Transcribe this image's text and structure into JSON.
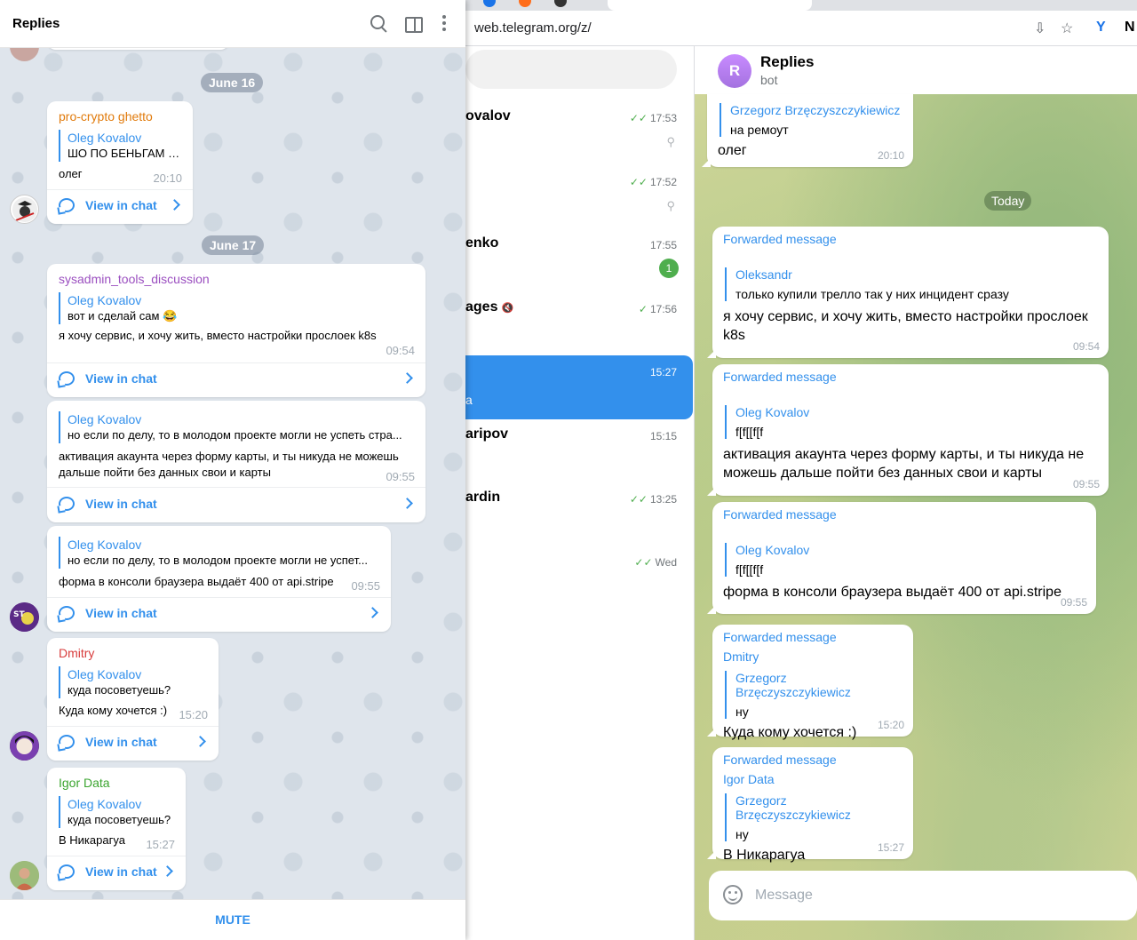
{
  "browser": {
    "url": "web.telegram.org/z/",
    "chats": [
      {
        "name": "ovalov",
        "time": "17:53",
        "check": "✓✓",
        "pinned": true
      },
      {
        "name": "",
        "time": "17:52",
        "check": "✓✓",
        "pinned": true
      },
      {
        "name": "enko",
        "time": "17:55",
        "badge": "1"
      },
      {
        "name": "ages",
        "time": "17:56",
        "check": "✓",
        "muted": true
      },
      {
        "name": "",
        "sub": "a",
        "time": "15:27",
        "active": true
      },
      {
        "name": "aripov",
        "time": "15:15"
      },
      {
        "name": "ardin",
        "time": "13:25",
        "check": "✓✓"
      },
      {
        "name": "",
        "time": "Wed",
        "check": "✓✓"
      }
    ]
  },
  "conversation": {
    "avatar_letter": "R",
    "title": "Replies",
    "subtitle": "bot",
    "today_label": "Today",
    "composer_placeholder": "Message",
    "bubbles": [
      {
        "quote_name": "Grzegorz Brzęczyszczykiewicz",
        "quote_text": "на ремоут",
        "text": "олег",
        "time": "20:10"
      },
      {
        "forwarded": "Forwarded message",
        "quote_name": "Oleksandr",
        "quote_text": "только купили трелло так у них инцидент сразу",
        "text": "я хочу сервис, и хочу жить, вместо настройки прослоек k8s",
        "time": "09:54"
      },
      {
        "forwarded": "Forwarded message",
        "quote_name": "Oleg Kovalov",
        "quote_text": "f[f[[f[f",
        "text": "активация акаунта через форму карты, и ты никуда не можешь дальше пойти без данных свои и карты",
        "time": "09:55"
      },
      {
        "forwarded": "Forwarded message",
        "quote_name": "Oleg Kovalov",
        "quote_text": "f[f[[f[f",
        "text": "форма в консоли браузера выдаёт 400 от api.stripe",
        "time": "09:55"
      },
      {
        "forwarded": "Forwarded message",
        "via": "Dmitry",
        "quote_name": "Grzegorz Brzęczyszczykiewicz",
        "quote_text": "ну",
        "text": "Куда кому хочется :)",
        "time": "15:20"
      },
      {
        "forwarded": "Forwarded message",
        "via": "Igor Data",
        "quote_name": "Grzegorz Brzęczyszczykiewicz",
        "quote_text": "ну",
        "text": "В Никарагуа",
        "time": "15:27"
      }
    ]
  },
  "replies_panel": {
    "title": "Replies",
    "dates": [
      "June 16",
      "June 17"
    ],
    "view_in_chat": "View in chat",
    "mute_label": "MUTE",
    "messages": [
      {
        "sender": "pro-crypto ghetto",
        "sender_color": "#e17b0c",
        "quote_name": "Oleg Kovalov",
        "quote_text": "ШО ПО БЕНЬГАМ ???",
        "text": "олег",
        "time": "20:10"
      },
      {
        "sender": "sysadmin_tools_discussion",
        "sender_color": "#9b4fc0",
        "quote_name": "Oleg Kovalov",
        "quote_text": "вот и сделай сам 😂",
        "text": "я хочу сервис, и хочу жить, вместо настройки прослоек k8s",
        "time": "09:54"
      },
      {
        "sender": "",
        "quote_name": "Oleg Kovalov",
        "quote_text": "но если по делу, то в молодом проекте могли не успеть стра...",
        "text": "активация акаунта через форму карты, и ты никуда не можешь дальше пойти без данных свои и карты",
        "time": "09:55"
      },
      {
        "sender": "",
        "quote_name": "Oleg Kovalov",
        "quote_text": "но если по делу, то в молодом проекте могли не успет...",
        "text": "форма в консоли браузера выдаёт 400 от api.stripe",
        "time": "09:55"
      },
      {
        "sender": "Dmitry",
        "sender_color": "#d83c3c",
        "quote_name": "Oleg Kovalov",
        "quote_text": "куда посоветуешь?",
        "text": "Куда кому хочется :)",
        "time": "15:20"
      },
      {
        "sender": "Igor Data",
        "sender_color": "#3ba52f",
        "quote_name": "Oleg Kovalov",
        "quote_text": "куда посоветуешь?",
        "text": "В Никарагуа",
        "time": "15:27"
      }
    ],
    "avatar_badge": "ST"
  }
}
